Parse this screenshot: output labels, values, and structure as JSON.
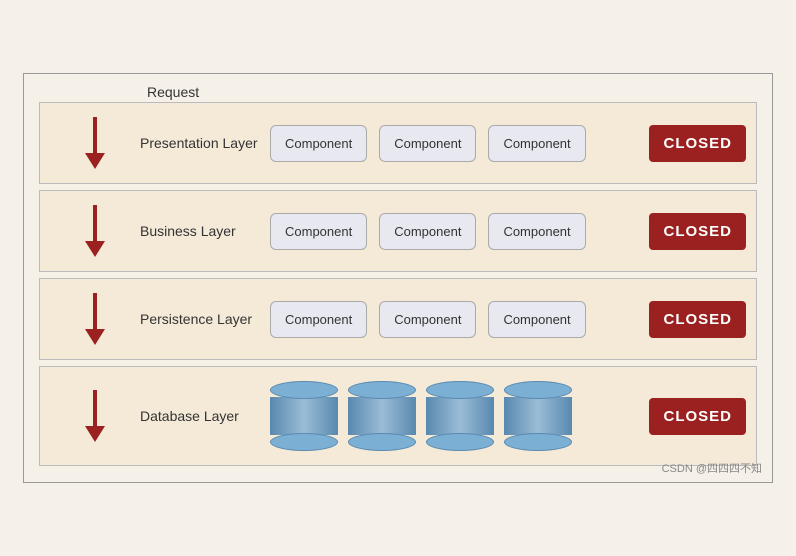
{
  "diagram": {
    "request_label": "Request",
    "layers": [
      {
        "id": "presentation",
        "label": "Presentation Layer",
        "components": [
          "Component",
          "Component",
          "Component"
        ],
        "closed_label": "CLOSED",
        "type": "component"
      },
      {
        "id": "business",
        "label": "Business Layer",
        "components": [
          "Component",
          "Component",
          "Component"
        ],
        "closed_label": "CLOSED",
        "type": "component"
      },
      {
        "id": "persistence",
        "label": "Persistence Layer",
        "components": [
          "Component",
          "Component",
          "Component"
        ],
        "closed_label": "CLOSED",
        "type": "component"
      },
      {
        "id": "database",
        "label": "Database Layer",
        "components": [],
        "closed_label": "CLOSED",
        "type": "database",
        "db_count": 4
      }
    ],
    "watermark": "CSDN @四四四不知"
  }
}
